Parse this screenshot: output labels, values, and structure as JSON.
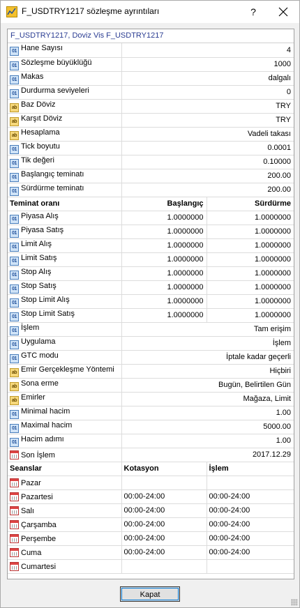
{
  "window": {
    "title": "F_USDTRY1217 sözleşme ayrıntıları",
    "help": "?",
    "close_button_label": "Kapat"
  },
  "panel_header": "F_USDTRY1217, Doviz Vis F_USDTRY1217",
  "props_top": [
    {
      "icon": "num",
      "label": "Hane Sayısı",
      "value": "4"
    },
    {
      "icon": "num",
      "label": "Sözleşme büyüklüğü",
      "value": "1000"
    },
    {
      "icon": "num",
      "label": "Makas",
      "value": "dalgalı"
    },
    {
      "icon": "num",
      "label": "Durdurma seviyeleri",
      "value": "0"
    },
    {
      "icon": "str",
      "label": "Baz Döviz",
      "value": "TRY"
    },
    {
      "icon": "str",
      "label": "Karşıt Döviz",
      "value": "TRY"
    },
    {
      "icon": "str",
      "label": "Hesaplama",
      "value": "Vadeli takası"
    },
    {
      "icon": "num",
      "label": "Tick boyutu",
      "value": "0.0001"
    },
    {
      "icon": "num",
      "label": "Tik değeri",
      "value": "0.10000"
    },
    {
      "icon": "num",
      "label": "Başlangıç teminatı",
      "value": "200.00"
    },
    {
      "icon": "num",
      "label": "Sürdürme teminatı",
      "value": "200.00"
    }
  ],
  "margin_header": {
    "label": "Teminat oranı",
    "col2": "Başlangıç",
    "col3": "Sürdürme"
  },
  "margin_rows": [
    {
      "label": "Piyasa Alış",
      "initial": "1.0000000",
      "maintenance": "1.0000000"
    },
    {
      "label": "Piyasa Satış",
      "initial": "1.0000000",
      "maintenance": "1.0000000"
    },
    {
      "label": "Limit Alış",
      "initial": "1.0000000",
      "maintenance": "1.0000000"
    },
    {
      "label": "Limit Satış",
      "initial": "1.0000000",
      "maintenance": "1.0000000"
    },
    {
      "label": "Stop Alış",
      "initial": "1.0000000",
      "maintenance": "1.0000000"
    },
    {
      "label": "Stop Satış",
      "initial": "1.0000000",
      "maintenance": "1.0000000"
    },
    {
      "label": "Stop Limit Alış",
      "initial": "1.0000000",
      "maintenance": "1.0000000"
    },
    {
      "label": "Stop Limit Satış",
      "initial": "1.0000000",
      "maintenance": "1.0000000"
    }
  ],
  "props_bottom": [
    {
      "icon": "num",
      "label": "İşlem",
      "value": "Tam erişim"
    },
    {
      "icon": "num",
      "label": "Uygulama",
      "value": "İşlem"
    },
    {
      "icon": "num",
      "label": "GTC modu",
      "value": "İptale kadar geçerli"
    },
    {
      "icon": "str",
      "label": "Emir Gerçekleşme Yöntemi",
      "value": "Hiçbiri"
    },
    {
      "icon": "str",
      "label": "Sona erme",
      "value": "Bugün, Belirtilen Gün"
    },
    {
      "icon": "str",
      "label": "Emirler",
      "value": "Mağaza, Limit"
    },
    {
      "icon": "num",
      "label": "Minimal hacim",
      "value": "1.00"
    },
    {
      "icon": "num",
      "label": "Maximal hacim",
      "value": "5000.00"
    },
    {
      "icon": "num",
      "label": "Hacim adımı",
      "value": "1.00"
    },
    {
      "icon": "cal",
      "label": "Son İşlem",
      "value": "2017.12.29"
    }
  ],
  "sessions_header": {
    "label": "Seanslar",
    "col2": "Kotasyon",
    "col3": "İşlem"
  },
  "sessions": [
    {
      "day": "Pazar",
      "quote": "",
      "trade": ""
    },
    {
      "day": "Pazartesi",
      "quote": "00:00-24:00",
      "trade": "00:00-24:00"
    },
    {
      "day": "Salı",
      "quote": "00:00-24:00",
      "trade": "00:00-24:00"
    },
    {
      "day": "Çarşamba",
      "quote": "00:00-24:00",
      "trade": "00:00-24:00"
    },
    {
      "day": "Perşembe",
      "quote": "00:00-24:00",
      "trade": "00:00-24:00"
    },
    {
      "day": "Cuma",
      "quote": "00:00-24:00",
      "trade": "00:00-24:00"
    },
    {
      "day": "Cumartesi",
      "quote": "",
      "trade": ""
    }
  ],
  "icon_glyphs": {
    "num": "01",
    "str": "ab"
  }
}
